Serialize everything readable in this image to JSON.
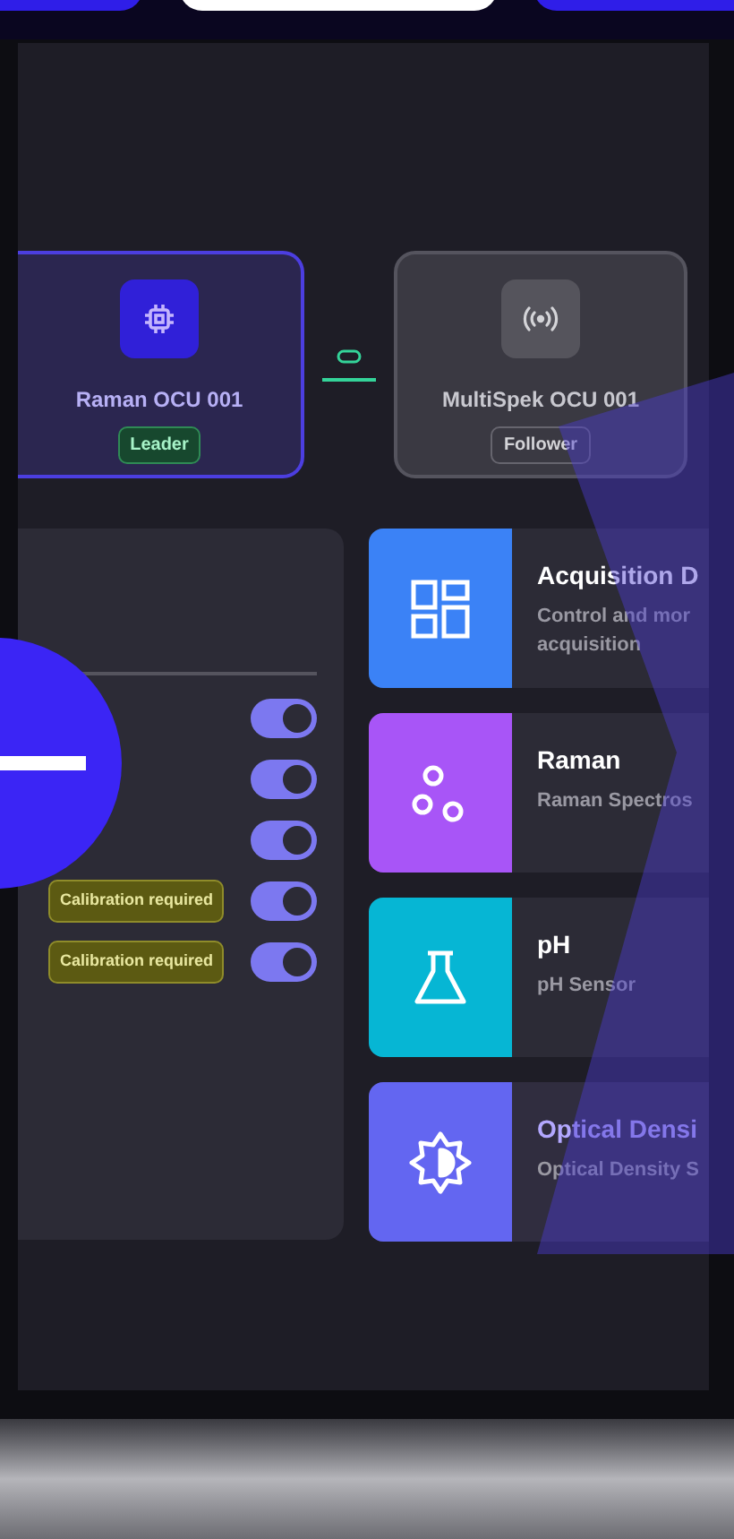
{
  "devices": [
    {
      "name": "Raman OCU 001",
      "role": "Leader",
      "selected": true
    },
    {
      "name": "MultiSpek OCU 001",
      "role": "Follower",
      "selected": false
    }
  ],
  "sensor_rows": [
    {
      "badge": "",
      "on": true
    },
    {
      "badge": "",
      "on": true
    },
    {
      "badge": "",
      "on": true
    },
    {
      "badge": "Calibration required",
      "on": true
    },
    {
      "badge": "Calibration required",
      "on": true
    }
  ],
  "modules": [
    {
      "kind": "grid",
      "title": "Acquisition D",
      "description": "Control and mor",
      "description_2": "acquisition",
      "color": "#3b82f6",
      "highlighted": false
    },
    {
      "kind": "dots",
      "title": "Raman",
      "description": "Raman Spectros",
      "color": "#a855f7",
      "highlighted": false
    },
    {
      "kind": "flask",
      "title": "pH",
      "description": "pH Sensor",
      "color": "#06b6d4",
      "highlighted": false
    },
    {
      "kind": "sun",
      "title": "Optical Densi",
      "description": "Optical Density S",
      "color": "#6366f1",
      "highlighted": true
    }
  ]
}
